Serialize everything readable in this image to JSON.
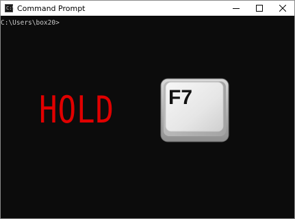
{
  "window": {
    "title": "Command Prompt",
    "app_icon_glyph": "C:\\"
  },
  "terminal": {
    "prompt": "C:\\Users\\box20>"
  },
  "overlay": {
    "instruction": "HOLD",
    "key_label": "F7",
    "instruction_color": "#e00000"
  },
  "icons": {
    "app": "command-prompt-icon",
    "minimize": "minimize-icon",
    "maximize": "maximize-icon",
    "close": "close-icon"
  }
}
